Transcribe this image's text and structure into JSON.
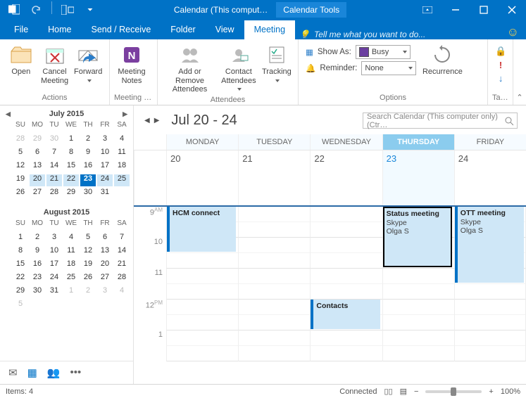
{
  "titlebar": {
    "title": "Calendar (This comput…",
    "tools_tab": "Calendar Tools"
  },
  "menubar": {
    "file": "File",
    "home": "Home",
    "sendrecv": "Send / Receive",
    "folder": "Folder",
    "view": "View",
    "meeting": "Meeting",
    "tell_me": "Tell me what you want to do..."
  },
  "ribbon": {
    "open": "Open",
    "cancel": "Cancel\nMeeting",
    "forward": "Forward",
    "actions_lbl": "Actions",
    "notes": "Meeting\nNotes",
    "notes_lbl": "Meeting N…",
    "add_remove": "Add or Remove\nAttendees",
    "contact": "Contact\nAttendees",
    "tracking": "Tracking",
    "attendees_lbl": "Attendees",
    "show_as_lbl": "Show As:",
    "show_as_val": "Busy",
    "reminder_lbl": "Reminder:",
    "reminder_val": "None",
    "recurrence": "Recurrence",
    "options_lbl": "Options",
    "tags_lbl": "Tags"
  },
  "mini_cal": {
    "july_title": "July 2015",
    "august_title": "August 2015",
    "dow": [
      "SU",
      "MO",
      "TU",
      "WE",
      "TH",
      "FR",
      "SA"
    ],
    "july": [
      "28",
      "29",
      "30",
      "1",
      "2",
      "3",
      "4",
      "5",
      "6",
      "7",
      "8",
      "9",
      "10",
      "11",
      "12",
      "13",
      "14",
      "15",
      "16",
      "17",
      "18",
      "19",
      "20",
      "21",
      "22",
      "23",
      "24",
      "25",
      "26",
      "27",
      "28",
      "29",
      "30",
      "31"
    ],
    "august": [
      "1",
      "2",
      "3",
      "4",
      "5",
      "6",
      "7",
      "8",
      "9",
      "10",
      "11",
      "12",
      "13",
      "14",
      "15",
      "16",
      "17",
      "18",
      "19",
      "20",
      "21",
      "22",
      "23",
      "24",
      "25",
      "26",
      "27",
      "28",
      "29",
      "30",
      "31",
      "1",
      "2",
      "3",
      "4",
      "5"
    ]
  },
  "calendar": {
    "range_title": "Jul 20 - 24",
    "search_placeholder": "Search Calendar (This computer only) (Ctr…",
    "days": [
      "MONDAY",
      "TUESDAY",
      "WEDNESDAY",
      "THURSDAY",
      "FRIDAY"
    ],
    "dates": [
      "20",
      "21",
      "22",
      "23",
      "24"
    ],
    "hours": [
      {
        "n": "9",
        "ap": "AM"
      },
      {
        "n": "10",
        "ap": ""
      },
      {
        "n": "11",
        "ap": ""
      },
      {
        "n": "12",
        "ap": "PM"
      },
      {
        "n": "1",
        "ap": ""
      }
    ],
    "appts": [
      {
        "title": "HCM connect",
        "loc": "",
        "who": "",
        "col": 0,
        "row": 0,
        "rows": 3,
        "selected": false
      },
      {
        "title": "Status meeting",
        "loc": "Skype",
        "who": "Olga S",
        "col": 3,
        "row": 0,
        "rows": 4,
        "selected": true
      },
      {
        "title": "OTT meeting",
        "loc": "Skype",
        "who": "Olga S",
        "col": 4,
        "row": 0,
        "rows": 5,
        "selected": false
      },
      {
        "title": "Contacts",
        "loc": "",
        "who": "",
        "col": 2,
        "row": 6,
        "rows": 2,
        "selected": false
      }
    ]
  },
  "statusbar": {
    "items": "Items: 4",
    "conn": "Connected",
    "zoom": "100%"
  }
}
